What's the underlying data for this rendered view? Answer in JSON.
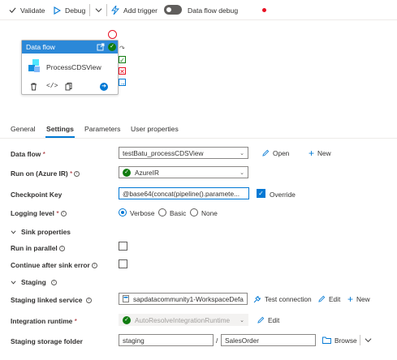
{
  "toolbar": {
    "validate_label": "Validate",
    "debug_label": "Debug",
    "add_trigger_label": "Add trigger",
    "data_flow_debug_label": "Data flow debug"
  },
  "activity": {
    "header": "Data flow",
    "name": "ProcessCDSView"
  },
  "tabs": [
    {
      "label": "General"
    },
    {
      "label": "Settings"
    },
    {
      "label": "Parameters"
    },
    {
      "label": "User properties"
    }
  ],
  "form": {
    "data_flow": {
      "label": "Data flow",
      "value": "testBatu_processCDSView",
      "open_label": "Open",
      "new_label": "New"
    },
    "run_on": {
      "label": "Run on (Azure IR)",
      "value": "AzureIR"
    },
    "checkpoint_key": {
      "label": "Checkpoint Key",
      "value": "@base64(concat(pipeline().paramete...",
      "override_label": "Override"
    },
    "logging_level": {
      "label": "Logging level",
      "options": [
        "Verbose",
        "Basic",
        "None"
      ],
      "selected": "Verbose"
    },
    "sink_properties_label": "Sink properties",
    "run_in_parallel_label": "Run in parallel",
    "continue_after_sink_error_label": "Continue after sink error",
    "staging_label": "Staging",
    "staging_linked_service": {
      "label": "Staging linked service",
      "value": "sapdatacommunity1-WorkspaceDefa",
      "test_connection_label": "Test connection",
      "edit_label": "Edit",
      "new_label": "New"
    },
    "integration_runtime": {
      "label": "Integration runtime",
      "value": "AutoResolveIntegrationRuntime",
      "edit_label": "Edit"
    },
    "staging_storage_folder": {
      "label": "Staging storage folder",
      "container": "staging",
      "separator": "/",
      "folder": "SalesOrder",
      "browse_label": "Browse"
    }
  },
  "colors": {
    "accent": "#0078d4",
    "success": "#107c10",
    "error": "#e81123",
    "activity_header": "#2b88d8"
  }
}
